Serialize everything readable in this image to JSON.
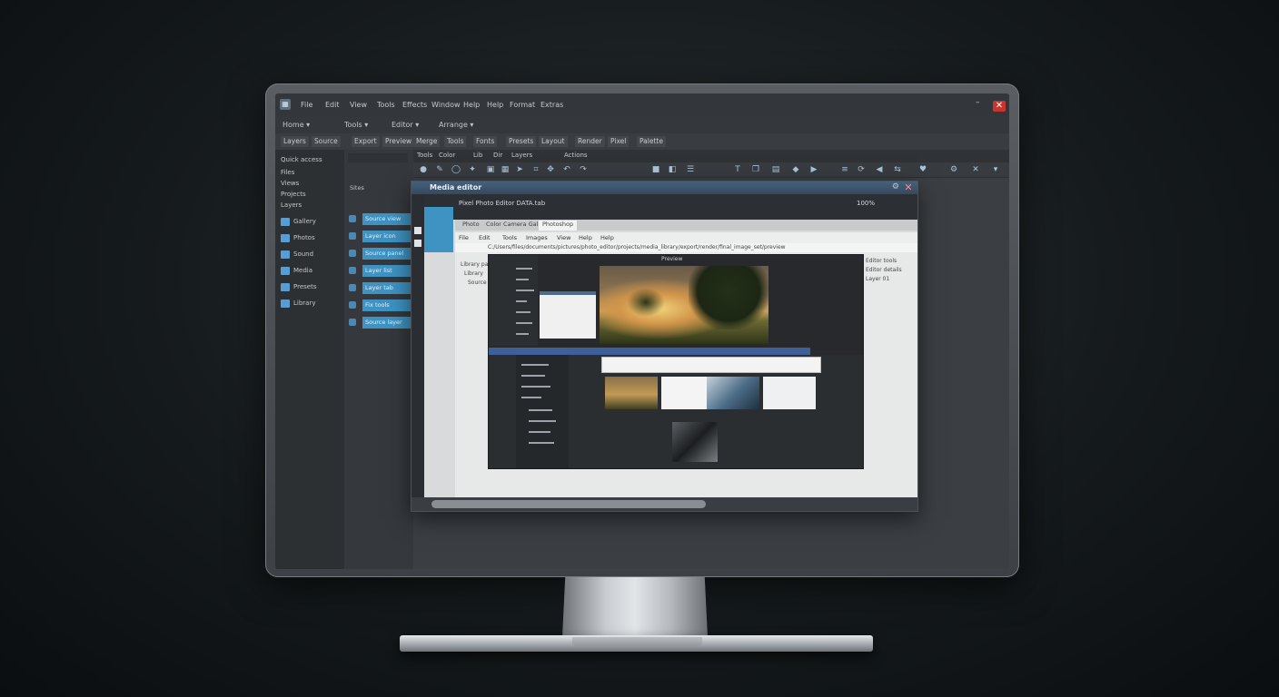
{
  "screen": {
    "caption": "text in menubar",
    "menu": [
      "File",
      "Edit",
      "View",
      "Tools",
      "Effects",
      "Window",
      "Help",
      "Help",
      "Format",
      "Extras"
    ],
    "window_min": "–",
    "window_close": "✕"
  },
  "row2": {
    "dropdowns": [
      "Home ▾",
      "Tools ▾",
      "Editor ▾",
      "Arrange ▾"
    ]
  },
  "row3": {
    "buttons": [
      "Layers",
      "Source",
      "Export",
      "Preview",
      "Merge",
      "Tools",
      "Fonts",
      "Presets",
      "Layout",
      "Render",
      "Pixel",
      "Palette"
    ]
  },
  "left_panel": {
    "header": "Quick access",
    "items": [
      "Files",
      "Views",
      "Projects",
      "Layers",
      "Gallery",
      "Photos",
      "Sound",
      "Media",
      "Presets",
      "Library"
    ]
  },
  "mid_panel": {
    "header": "Sites",
    "items": [
      "Source view",
      "Layer icon",
      "Source panel",
      "Layer list",
      "Layer tab",
      "Fix tools",
      "Source layer"
    ]
  },
  "main_tabs": [
    "Tools",
    "Color",
    "Lib",
    "Dir",
    "Layers",
    "Actions"
  ],
  "dialog": {
    "title": "Media editor",
    "subtitle": "Pixel Photo Editor DATA.tab",
    "zoom": "100%",
    "tabs": [
      "Photo",
      "Color Camera Gallery",
      "Photoshop"
    ],
    "menu": [
      "File",
      "Edit",
      "Tools",
      "Images",
      "View",
      "Help",
      "Help"
    ],
    "path": "C:/Users/files/documents/pictures/photo_editor/projects/media_library/export/render/final_image_set/preview",
    "side_left": [
      "Library page",
      "Library",
      "Source"
    ],
    "side_right": [
      "Editor tools",
      "Editor details",
      "Layer 01"
    ],
    "inner_label": "Preview"
  },
  "colors": {
    "accent": "#3e93c3",
    "title_bar": "#35495e",
    "close": "#c9342d"
  }
}
